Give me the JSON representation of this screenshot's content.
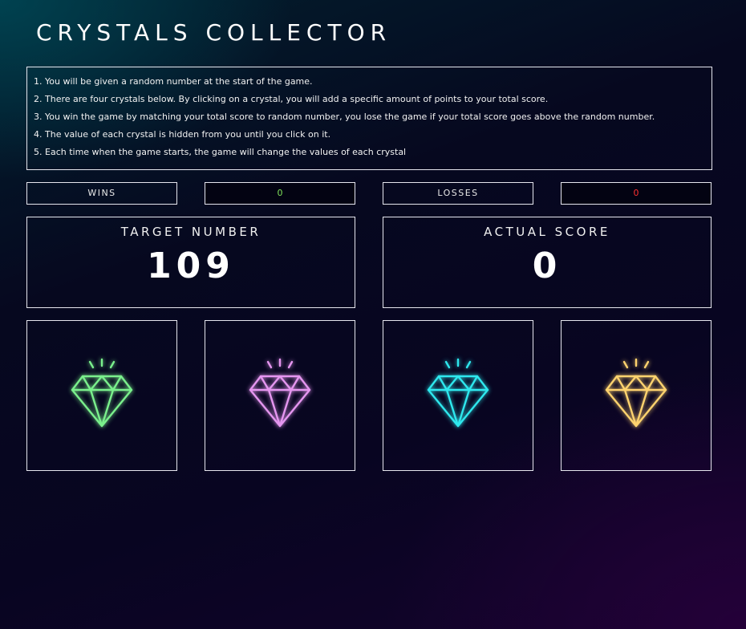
{
  "header": {
    "title": "CRYSTALS COLLECTOR"
  },
  "rules": [
    "You will be given a random number at the start of the game.",
    "There are four crystals below. By clicking on a crystal, you will add a specific amount of points to your total score.",
    "You win the game by matching your total score to random number, you lose the game if your total score goes above the random number.",
    "The value of each crystal is hidden from you until you click on it.",
    "Each time when the game starts, the game will change the values of each crystal"
  ],
  "stats": {
    "wins_label": "WINS",
    "wins_value": "0",
    "losses_label": "LOSSES",
    "losses_value": "0"
  },
  "target": {
    "label": "TARGET NUMBER",
    "value": "109"
  },
  "score": {
    "label": "ACTUAL SCORE",
    "value": "0"
  },
  "crystals": [
    {
      "icon": "green-diamond-icon",
      "color": "#7af08c"
    },
    {
      "icon": "pink-diamond-icon",
      "color": "#e596f0"
    },
    {
      "icon": "cyan-diamond-icon",
      "color": "#2ee8ee"
    },
    {
      "icon": "gold-diamond-icon",
      "color": "#ffd36e"
    }
  ]
}
